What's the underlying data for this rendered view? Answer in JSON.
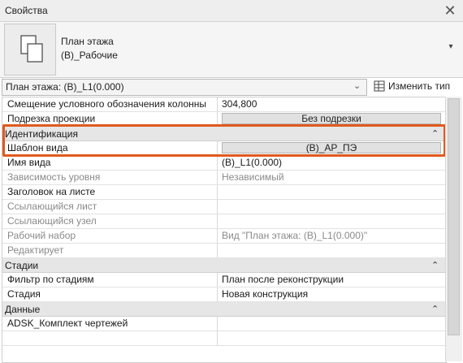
{
  "window": {
    "title": "Свойства",
    "close_symbol": "✕"
  },
  "type_selector": {
    "name_line1": "План этажа",
    "name_line2": "(В)_Рабочие",
    "dropdown_symbol": "▾",
    "icon": "view-type-icon"
  },
  "instance_selector": {
    "value": "План этажа: (В)_L1(0.000)",
    "chevron": "⌄",
    "edit_type_label": "Изменить тип"
  },
  "rows": {
    "r1": {
      "name": "Смещение условного обозначения колонны",
      "value": "304,800"
    },
    "r2": {
      "name": "Подрезка проекции",
      "value": "Без подрезки"
    },
    "g1": {
      "label": "Идентификация",
      "collapse": "⌃"
    },
    "r3": {
      "name": "Шаблон вида",
      "value": "(В)_АР_ПЭ"
    },
    "r4": {
      "name": "Имя вида",
      "value": "(В)_L1(0.000)"
    },
    "r5": {
      "name": "Зависимость уровня",
      "value": "Независимый"
    },
    "r6": {
      "name": "Заголовок на листе",
      "value": ""
    },
    "r7": {
      "name": "Ссылающийся лист",
      "value": ""
    },
    "r8": {
      "name": "Ссылающийся узел",
      "value": ""
    },
    "r9": {
      "name": "Рабочий набор",
      "value": "Вид \"План этажа: (В)_L1(0.000)\""
    },
    "r10": {
      "name": "Редактирует",
      "value": ""
    },
    "g2": {
      "label": "Стадии",
      "collapse": "⌃"
    },
    "r11": {
      "name": "Фильтр по стадиям",
      "value": "План после реконструкции"
    },
    "r12": {
      "name": "Стадия",
      "value": "Новая конструкция"
    },
    "g3": {
      "label": "Данные",
      "collapse": "⌃"
    },
    "r13": {
      "name": "ADSK_Комплект чертежей",
      "value": ""
    }
  },
  "scrollbar": {
    "up_symbol": "▲"
  },
  "colors": {
    "highlight": "#e05a1e",
    "group_bg": "#e6e6e6",
    "disabled_text": "#8a8a8a"
  }
}
